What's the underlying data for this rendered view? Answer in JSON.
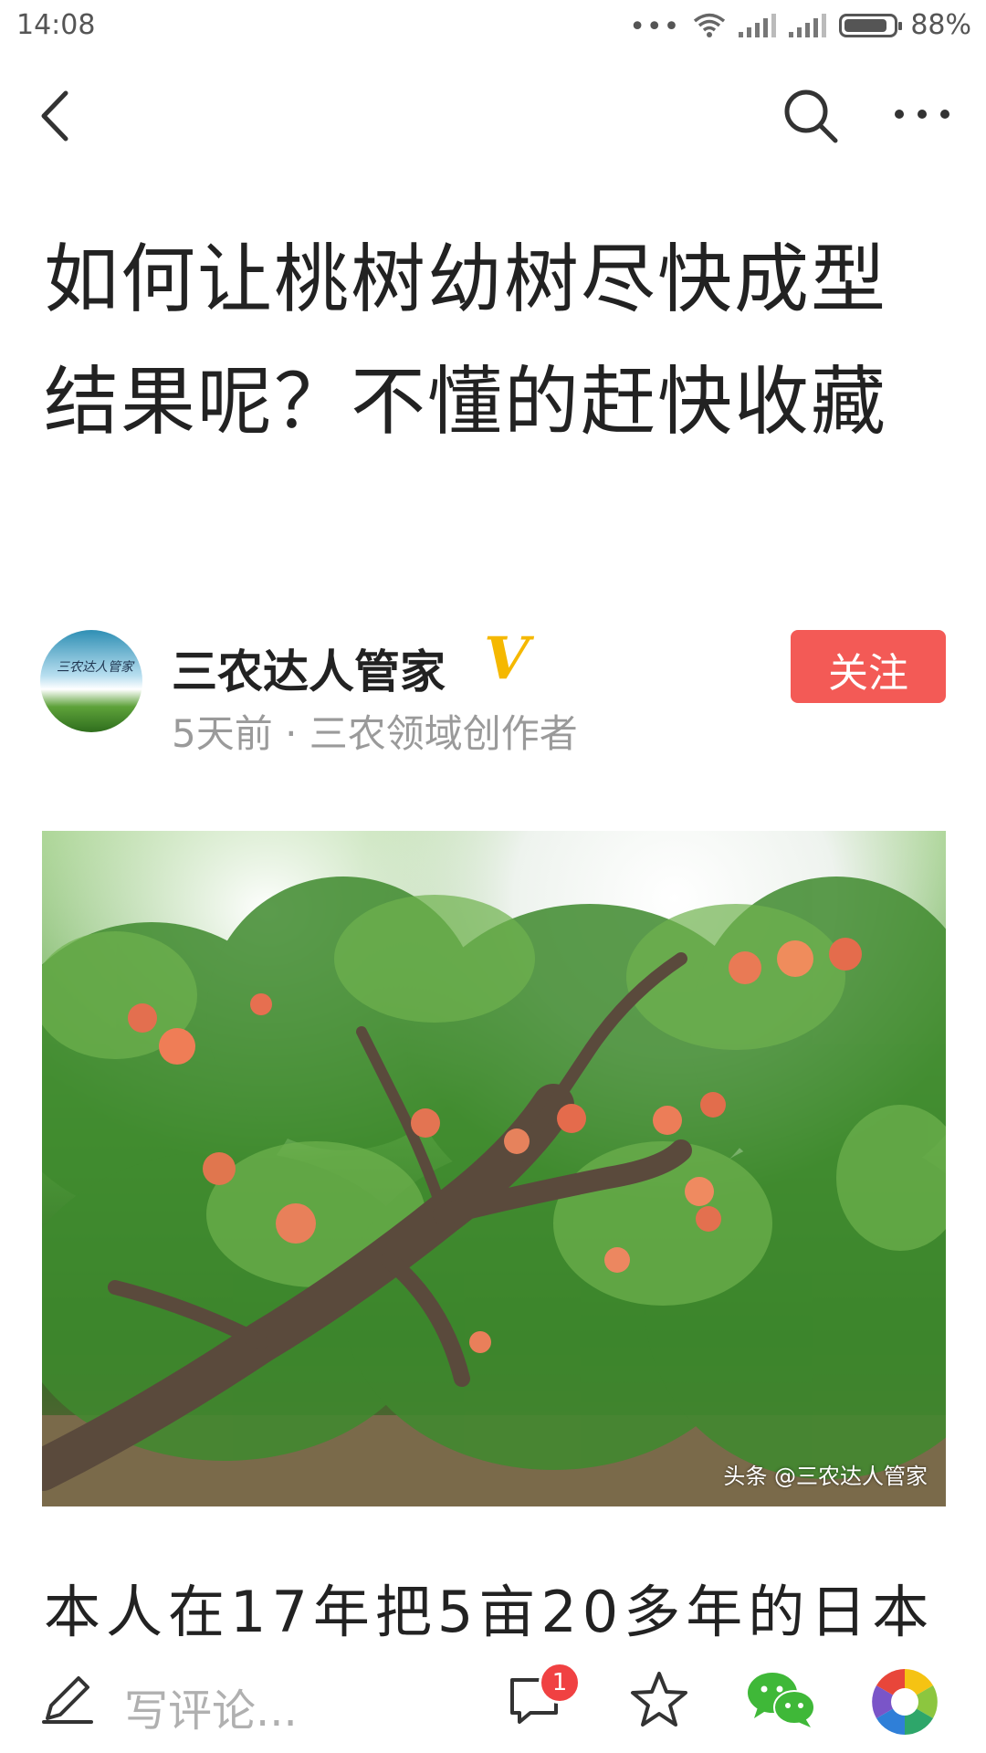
{
  "status_bar": {
    "time": "14:08",
    "dots": "•••",
    "battery_level": 0.88,
    "battery_text": "88%"
  },
  "nav": {
    "back_icon": "back-chevron-icon",
    "search_icon": "search-icon",
    "more_icon": "more-dots-icon"
  },
  "article": {
    "title": "如何让桃树幼树尽快成型结果呢？不懂的赶快收藏",
    "author": {
      "name": "三农达人管家",
      "verified_mark": "V",
      "verified_color": "#f5b800",
      "meta": "5天前 · 三农领域创作者",
      "follow_label": "关注",
      "follow_color": "#f35a56"
    },
    "image": {
      "watermark": "头条 @三农达人管家"
    },
    "body_first_line": "本人在17年把5亩20多年的日本"
  },
  "bottom_bar": {
    "comment_placeholder": "写评论...",
    "comment_count": "1",
    "badge_color": "#f04142",
    "icons": [
      "edit-icon",
      "comment-icon",
      "favorite-star-icon",
      "wechat-icon",
      "moments-icon"
    ]
  }
}
